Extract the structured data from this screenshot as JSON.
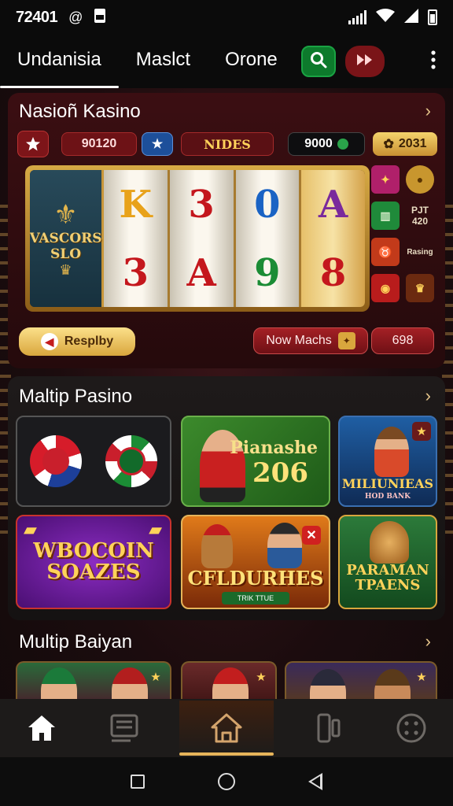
{
  "status_bar": {
    "time": "72401",
    "icons": [
      "at-sign-icon",
      "sim-card-icon",
      "signal-icon",
      "wifi-icon",
      "signal-strength-icon",
      "battery-icon"
    ]
  },
  "top_nav": {
    "tabs": [
      {
        "label": "Undanisia",
        "active": true
      },
      {
        "label": "Maslct",
        "active": false
      },
      {
        "label": "Orone",
        "active": false
      }
    ],
    "icons": [
      "search-icon",
      "fast-forward-icon",
      "more-vertical-icon"
    ]
  },
  "section1": {
    "title": "Nasioñ Kasino",
    "stat_balance": "90120",
    "nides_label": "NIDES",
    "stat_coins": "9000",
    "stat_gems": "2031",
    "slot_logo_text": "VASCORS SLO",
    "reel_symbols": [
      [
        "K",
        "3"
      ],
      [
        "3",
        "A"
      ],
      [
        "0",
        "9"
      ],
      [
        "A",
        "8"
      ]
    ],
    "side_stats": {
      "label": "PJT",
      "value": "420",
      "tag": "Rasing"
    },
    "replay_button": "Resplby",
    "now_button": "Now Machs",
    "counter_value": "698",
    "accent_gold": "#d9a63d",
    "accent_red": "#a42025"
  },
  "section2": {
    "title": "Maltip Pasino",
    "tiles": [
      {
        "title": "",
        "subtitle": ""
      },
      {
        "title": "Pianashe",
        "subtitle": "206"
      },
      {
        "title": "MILIUNIEAS",
        "subtitle": "HOD BANK"
      },
      {
        "title": "WBOCOIN",
        "subtitle": "SOAZES"
      },
      {
        "title": "CFLDURHES",
        "subtitle": "TRIK TTUE"
      },
      {
        "title": "PARAMAN",
        "subtitle": "TPAENS"
      }
    ]
  },
  "section3": {
    "title": "Multip Baiyan"
  },
  "bottom_nav": {
    "icons": [
      "home-icon",
      "list-icon",
      "house-outline-icon",
      "device-icon",
      "grid-dots-icon"
    ]
  },
  "system_nav": {
    "icons": [
      "recents-icon",
      "home-circle-icon",
      "back-icon"
    ]
  }
}
